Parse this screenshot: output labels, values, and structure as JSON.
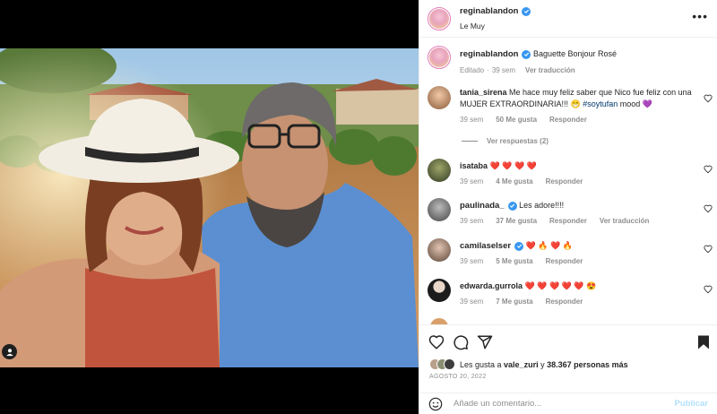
{
  "post": {
    "author": "reginablandon",
    "location": "Le Muy",
    "caption": "Baguette Bonjour Rosé",
    "caption_meta": {
      "edited": "Editado",
      "sep": "·",
      "time": "39 sem",
      "translate": "Ver traducción"
    }
  },
  "comments": [
    {
      "user": "tania_sirena",
      "verified": false,
      "text": "Me hace muy feliz saber que Nico fue feliz con una MUJER EXTRAORDINARIA!!! 😁 ",
      "hashtag": "#soytufan",
      "after": " mood 💜",
      "time": "39 sem",
      "likes": "50 Me gusta",
      "reply": "Responder",
      "translate": "",
      "view_replies": "Ver respuestas (2)"
    },
    {
      "user": "isataba",
      "verified": false,
      "text": "❤️ ❤️ ❤️ ❤️",
      "time": "39 sem",
      "likes": "4 Me gusta",
      "reply": "Responder",
      "translate": ""
    },
    {
      "user": "paulinada_",
      "verified": true,
      "text": "Les adore!!!!",
      "time": "39 sem",
      "likes": "37 Me gusta",
      "reply": "Responder",
      "translate": "Ver traducción"
    },
    {
      "user": "camilaselser",
      "verified": true,
      "text": "❤️ 🔥 ❤️ 🔥",
      "time": "39 sem",
      "likes": "5 Me gusta",
      "reply": "Responder",
      "translate": ""
    },
    {
      "user": "edwarda.gurrola",
      "verified": false,
      "text": "❤️ ❤️ ❤️ ❤️ ❤️ 😍",
      "time": "39 sem",
      "likes": "7 Me gusta",
      "reply": "Responder",
      "translate": ""
    }
  ],
  "likes_line": {
    "prefix": "Les gusta a ",
    "user": "vale_zuri",
    "middle": " y ",
    "count": "38.367 personas más"
  },
  "date": "AGOSTO 20, 2022",
  "composer": {
    "placeholder": "Añade un comentario...",
    "publish": "Publicar"
  },
  "icons": [
    "user-tag-icon",
    "verified-badge-icon",
    "more-options-icon",
    "heart-icon",
    "comment-icon",
    "share-icon",
    "bookmark-icon",
    "emoji-icon"
  ],
  "colors": {
    "verified": "#3897f0",
    "link": "#00376b",
    "muted": "#8e8e8e",
    "publish_disabled": "#b2dffc",
    "avatar_ring": "#e27bb7"
  }
}
